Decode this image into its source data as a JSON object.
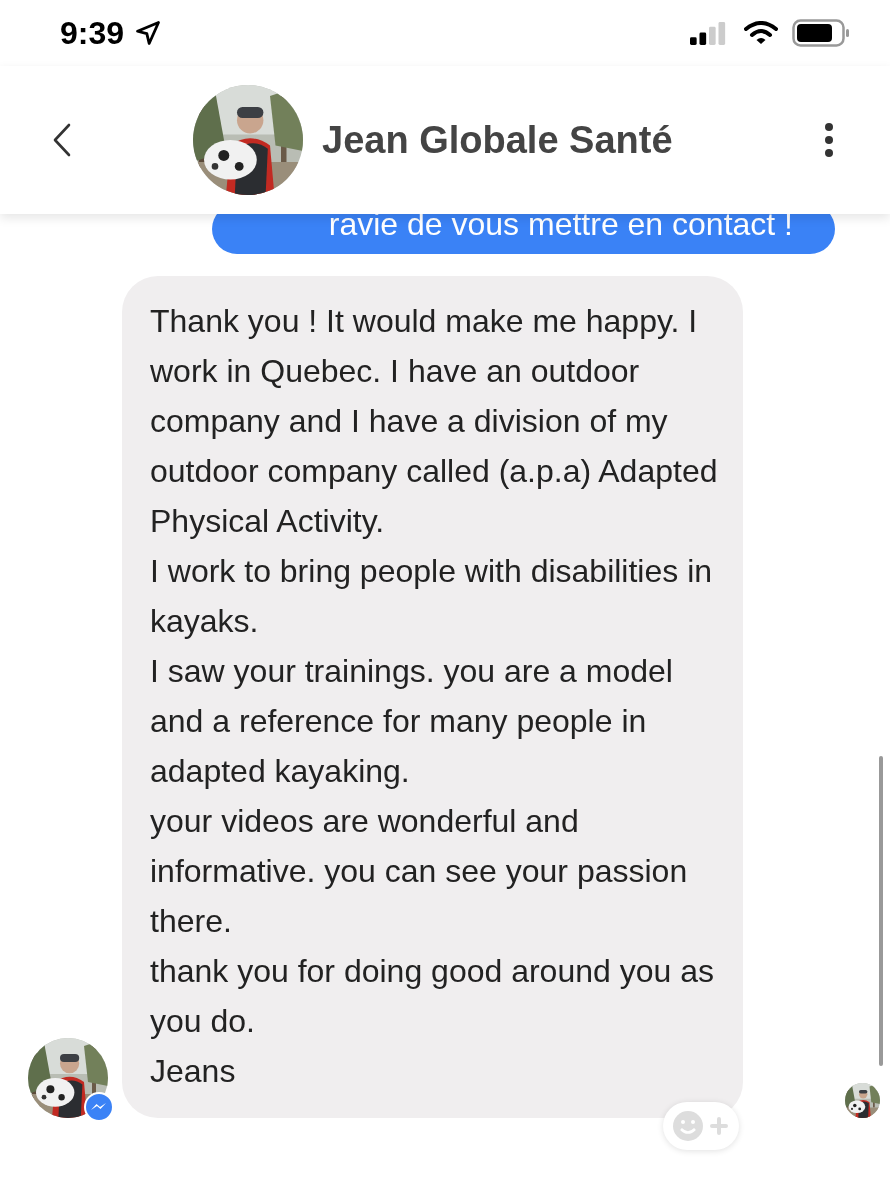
{
  "status_bar": {
    "time": "9:39",
    "location_active": true
  },
  "header": {
    "title": "Jean Globale Santé"
  },
  "messages": [
    {
      "kind": "sent",
      "paragraphs": [
        "ravie de vous mettre en contact !"
      ]
    },
    {
      "kind": "received",
      "paragraphs": [
        "Thank you ! It would make me happy. I work in Quebec. I have an outdoor company and I have a division of my outdoor company called (a.p.a) Adapted Physical Activity.",
        "I work to bring people with disabilities in kayaks.",
        "I saw your trainings. you are a model and a reference for many people in adapted kayaking.",
        "your videos are wonderful and informative. you can see your passion there.",
        "thank you for doing good around you as you do.",
        "Jeans"
      ]
    }
  ]
}
